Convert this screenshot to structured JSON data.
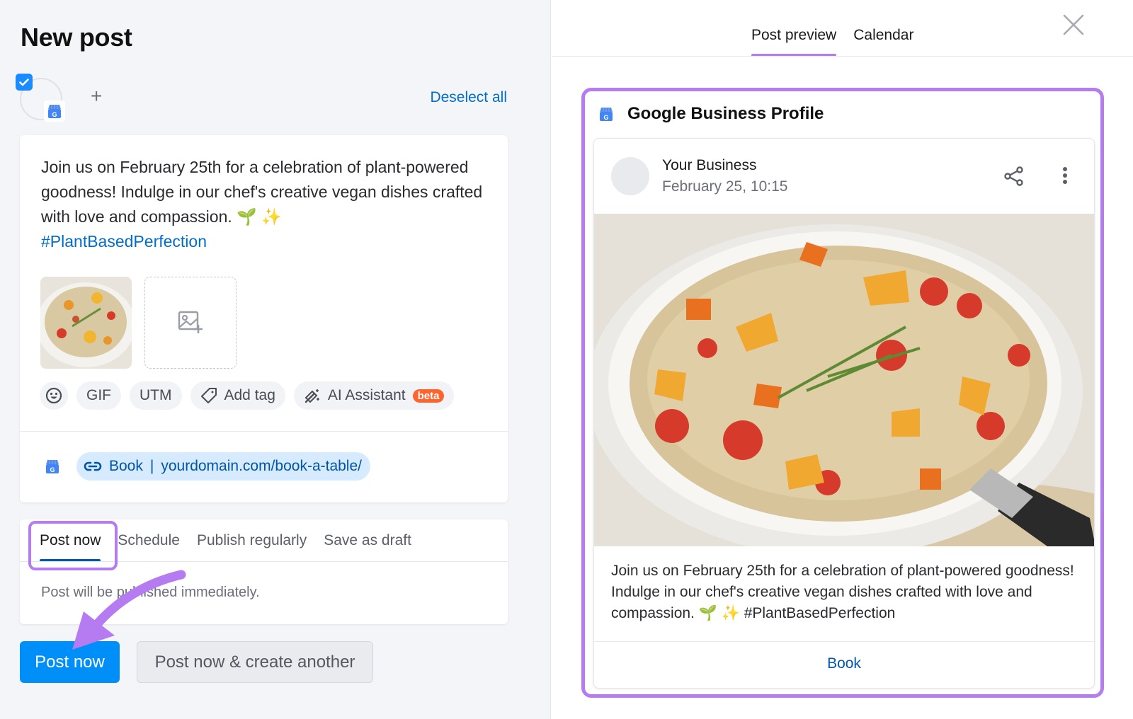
{
  "header": {
    "title": "New post"
  },
  "profiles": {
    "selected": true,
    "network_icon": "google-business-profile-icon",
    "add_label": "+",
    "deselect_label": "Deselect all"
  },
  "composer": {
    "text": "Join us on February 25th for a celebration of plant-powered goodness! Indulge in our chef's creative vegan dishes crafted with love and compassion. 🌱 ✨",
    "hashtag": "#PlantBasedPerfection",
    "media": [
      {
        "type": "image",
        "alt": "Quinoa salad with tomatoes and oranges in a pan"
      }
    ],
    "add_media_icon": "add-image-icon",
    "toolbar": {
      "emoji_icon": "emoji-icon",
      "gif_label": "GIF",
      "utm_label": "UTM",
      "add_tag_label": "Add tag",
      "ai_assistant_label": "AI Assistant",
      "beta_label": "beta"
    },
    "cta": {
      "network_icon": "google-business-profile-icon",
      "label": "Book",
      "separator": "|",
      "url": "yourdomain.com/book-a-table/"
    }
  },
  "publish": {
    "tabs": [
      {
        "label": "Post now",
        "active": true
      },
      {
        "label": "Schedule",
        "active": false
      },
      {
        "label": "Publish regularly",
        "active": false
      },
      {
        "label": "Save as draft",
        "active": false
      }
    ],
    "note": "Post will be published immediately.",
    "primary_button": "Post now",
    "secondary_button": "Post now & create another"
  },
  "preview": {
    "tabs": [
      {
        "label": "Post preview",
        "active": true
      },
      {
        "label": "Calendar",
        "active": false
      }
    ],
    "network_title": "Google Business Profile",
    "business_name": "Your Business",
    "date": "February 25, 10:15",
    "text": "Join us on February 25th for a celebration of plant-powered goodness! Indulge in our chef's creative vegan dishes crafted with love and compassion. 🌱 ✨ #PlantBasedPerfection",
    "cta_label": "Book"
  },
  "colors": {
    "accent_blue": "#008ff8",
    "link_blue": "#006dca",
    "annotation_purple": "#b57bf0",
    "beta_orange": "#ff642d"
  }
}
